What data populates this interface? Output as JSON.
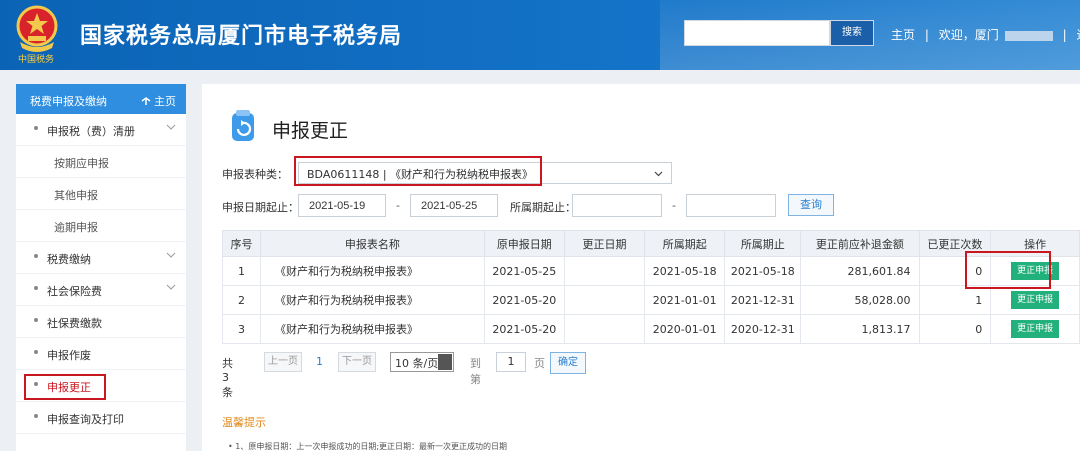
{
  "header": {
    "title": "国家税务总局厦门市电子税务局",
    "slogan": "中国税务",
    "search_value": "",
    "search_button": "搜索",
    "nav_home": "主页",
    "nav_sep1": "|",
    "nav_welcome": "欢迎，厦门",
    "nav_sep2": "|",
    "nav_logout": "退"
  },
  "sidebar": {
    "header_title": "税费申报及缴纳",
    "header_home": "主页",
    "items": [
      {
        "label": "申报税（费）清册",
        "level": 1,
        "expandable": true
      },
      {
        "label": "按期应申报",
        "level": 2
      },
      {
        "label": "其他申报",
        "level": 2
      },
      {
        "label": "逾期申报",
        "level": 2
      },
      {
        "label": "税费缴纳",
        "level": 1,
        "expandable": true
      },
      {
        "label": "社会保险费",
        "level": 1,
        "expandable": true
      },
      {
        "label": "社保费缴款",
        "level": 1
      },
      {
        "label": "申报作废",
        "level": 1
      },
      {
        "label": "申报更正",
        "level": 1,
        "selected": true
      },
      {
        "label": "申报查询及打印",
        "level": 1
      }
    ]
  },
  "main": {
    "title": "申报更正",
    "form": {
      "type_label": "申报表种类：",
      "type_value": "BDA0611148 | 《财产和行为税纳税申报表》",
      "date_label": "申报日期起止：",
      "date_start": "2021-05-19",
      "date_sep": "-",
      "date_end": "2021-05-25",
      "period_label": "所属期起止：",
      "period_start": "",
      "period_sep": "-",
      "period_end": "",
      "query_button": "查询"
    },
    "table": {
      "headers": [
        "序号",
        "申报表名称",
        "原申报日期",
        "更正日期",
        "所属期起",
        "所属期止",
        "更正前应补退金额",
        "已更正次数",
        "操作"
      ],
      "rows": [
        {
          "no": "1",
          "name": "《财产和行为税纳税申报表》",
          "orig_date": "2021-05-25",
          "corr_date": "",
          "period_start": "2021-05-18",
          "period_end": "2021-05-18",
          "amount": "281,601.84",
          "count": "0",
          "action": "更正申报"
        },
        {
          "no": "2",
          "name": "《财产和行为税纳税申报表》",
          "orig_date": "2021-05-20",
          "corr_date": "",
          "period_start": "2021-01-01",
          "period_end": "2021-12-31",
          "amount": "58,028.00",
          "count": "1",
          "action": "更正申报"
        },
        {
          "no": "3",
          "name": "《财产和行为税纳税申报表》",
          "orig_date": "2021-05-20",
          "corr_date": "",
          "period_start": "2020-01-01",
          "period_end": "2020-12-31",
          "amount": "1,813.17",
          "count": "0",
          "action": "更正申报"
        }
      ]
    },
    "pager": {
      "total": "共 3 条",
      "prev": "上一页",
      "current": "1",
      "next": "下一页",
      "page_size": "10 条/页",
      "goto_label": "到第",
      "goto_value": "1",
      "page_unit": "页",
      "confirm": "确定"
    },
    "tips": {
      "title": "温馨提示",
      "line1": "• 1、原申报日期：上一次申报成功的日期;更正日期：最新一次更正成功的日期"
    }
  },
  "colors": {
    "header_blue": "#1473c8",
    "sidebar_head": "#2f8ee0",
    "action_green": "#22b07d",
    "highlight_red": "#c8171e",
    "tip_orange": "#e08a1e"
  },
  "icons": [
    "national-emblem-icon",
    "home-arrow-icon",
    "chevron-down-icon",
    "refresh-document-icon",
    "select-arrow-icon"
  ]
}
